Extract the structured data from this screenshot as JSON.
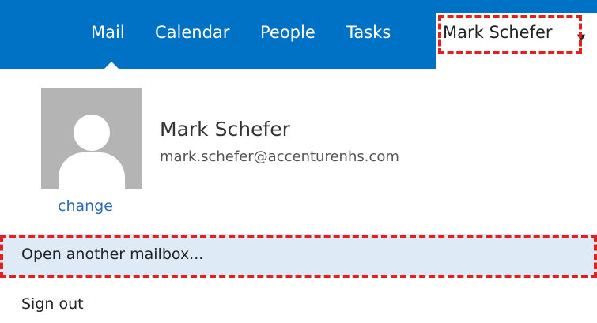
{
  "nav": {
    "items": [
      {
        "label": "Mail",
        "active": true
      },
      {
        "label": "Calendar"
      },
      {
        "label": "People"
      },
      {
        "label": "Tasks"
      }
    ],
    "bar_color": "#0072c6"
  },
  "user_menu": {
    "label": "Mark Schefer",
    "chevron_icon": "chevron-down-icon"
  },
  "profile": {
    "name": "Mark Schefer",
    "email": "mark.schefer@accenturenhs.com",
    "change_label": "change",
    "avatar_icon": "person-placeholder-icon"
  },
  "menu": {
    "open_mailbox": "Open another mailbox...",
    "sign_out": "Sign out"
  },
  "annotation_color": "#e32020",
  "hover_color": "#deebf7"
}
